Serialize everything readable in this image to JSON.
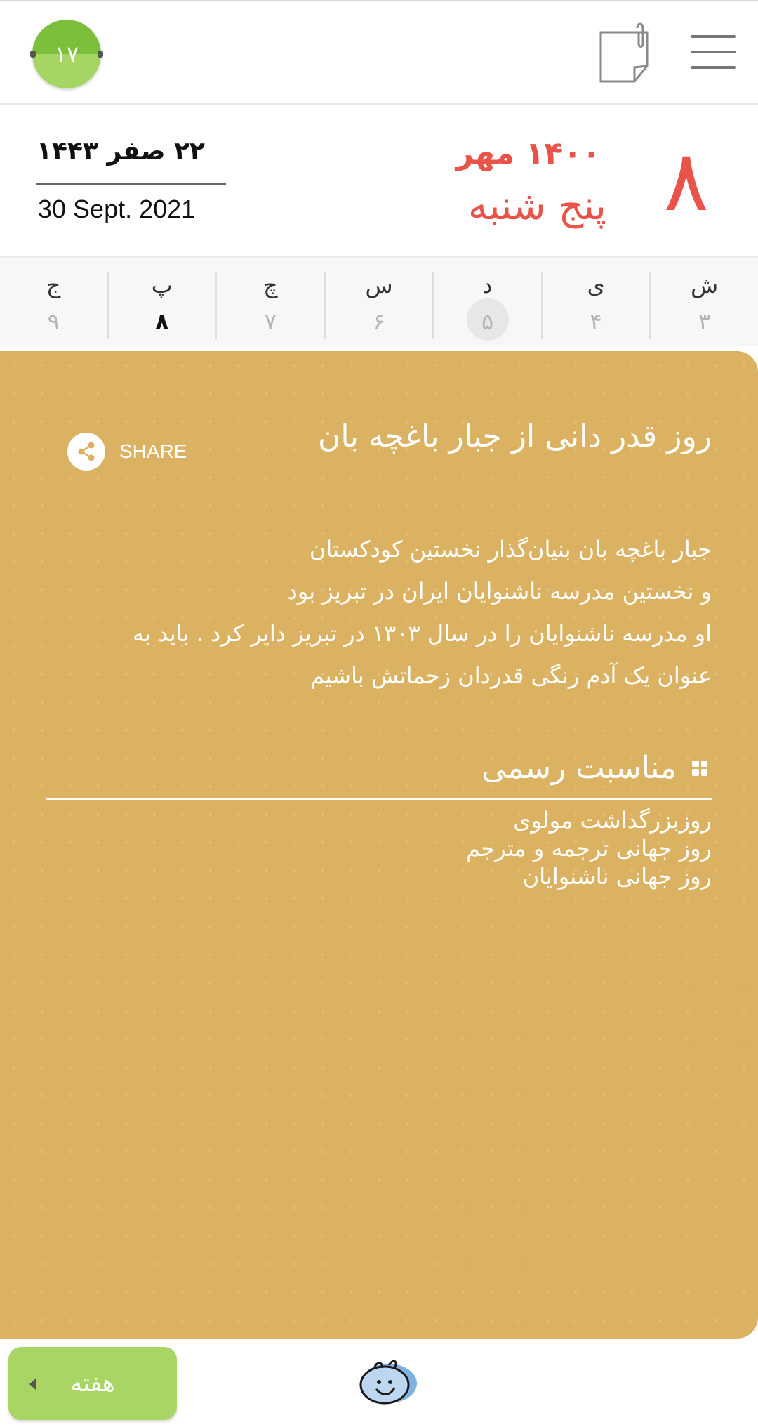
{
  "topbar": {
    "badge_number": "۱۷",
    "icons": [
      "notes-icon",
      "menu-icon"
    ]
  },
  "date": {
    "persian_day": "۸",
    "persian_month_year": "۱۴۰۰ مهر",
    "persian_weekday": "پنج شنبه",
    "hijri": "۲۲ صفر ۱۴۴۳",
    "gregorian": "30 Sept. 2021"
  },
  "week": [
    {
      "name": "ش",
      "num": "۳"
    },
    {
      "name": "ی",
      "num": "۴"
    },
    {
      "name": "د",
      "num": "۵"
    },
    {
      "name": "س",
      "num": "۶"
    },
    {
      "name": "چ",
      "num": "۷"
    },
    {
      "name": "پ",
      "num": "۸"
    },
    {
      "name": "ج",
      "num": "۹"
    }
  ],
  "card": {
    "title": "روز قدر دانی از جبار باغچه بان",
    "share_label": "SHARE",
    "description": [
      "جبار باغچه بان بنیان‌گذار نخستین کودکستان",
      "و نخستین مدرسه ناشنوایان ایران در تبریز بود",
      "او مدرسه ناشنوایان را در سال ۱۳۰۳ در تبریز دایر کرد . باید به",
      "عنوان یک آدم رنگی قدردان زحماتش باشیم"
    ],
    "section_title": "مناسبت رسمی",
    "events": [
      "روزبزرگداشت مولوی",
      "روز جهانی ترجمه و مترجم",
      "روز جهانی ناشنوایان"
    ]
  },
  "bottom": {
    "week_button": "هفته"
  },
  "colors": {
    "accent_red": "#e8534a",
    "card_bg": "#dbb262",
    "green": "#a8d563"
  }
}
